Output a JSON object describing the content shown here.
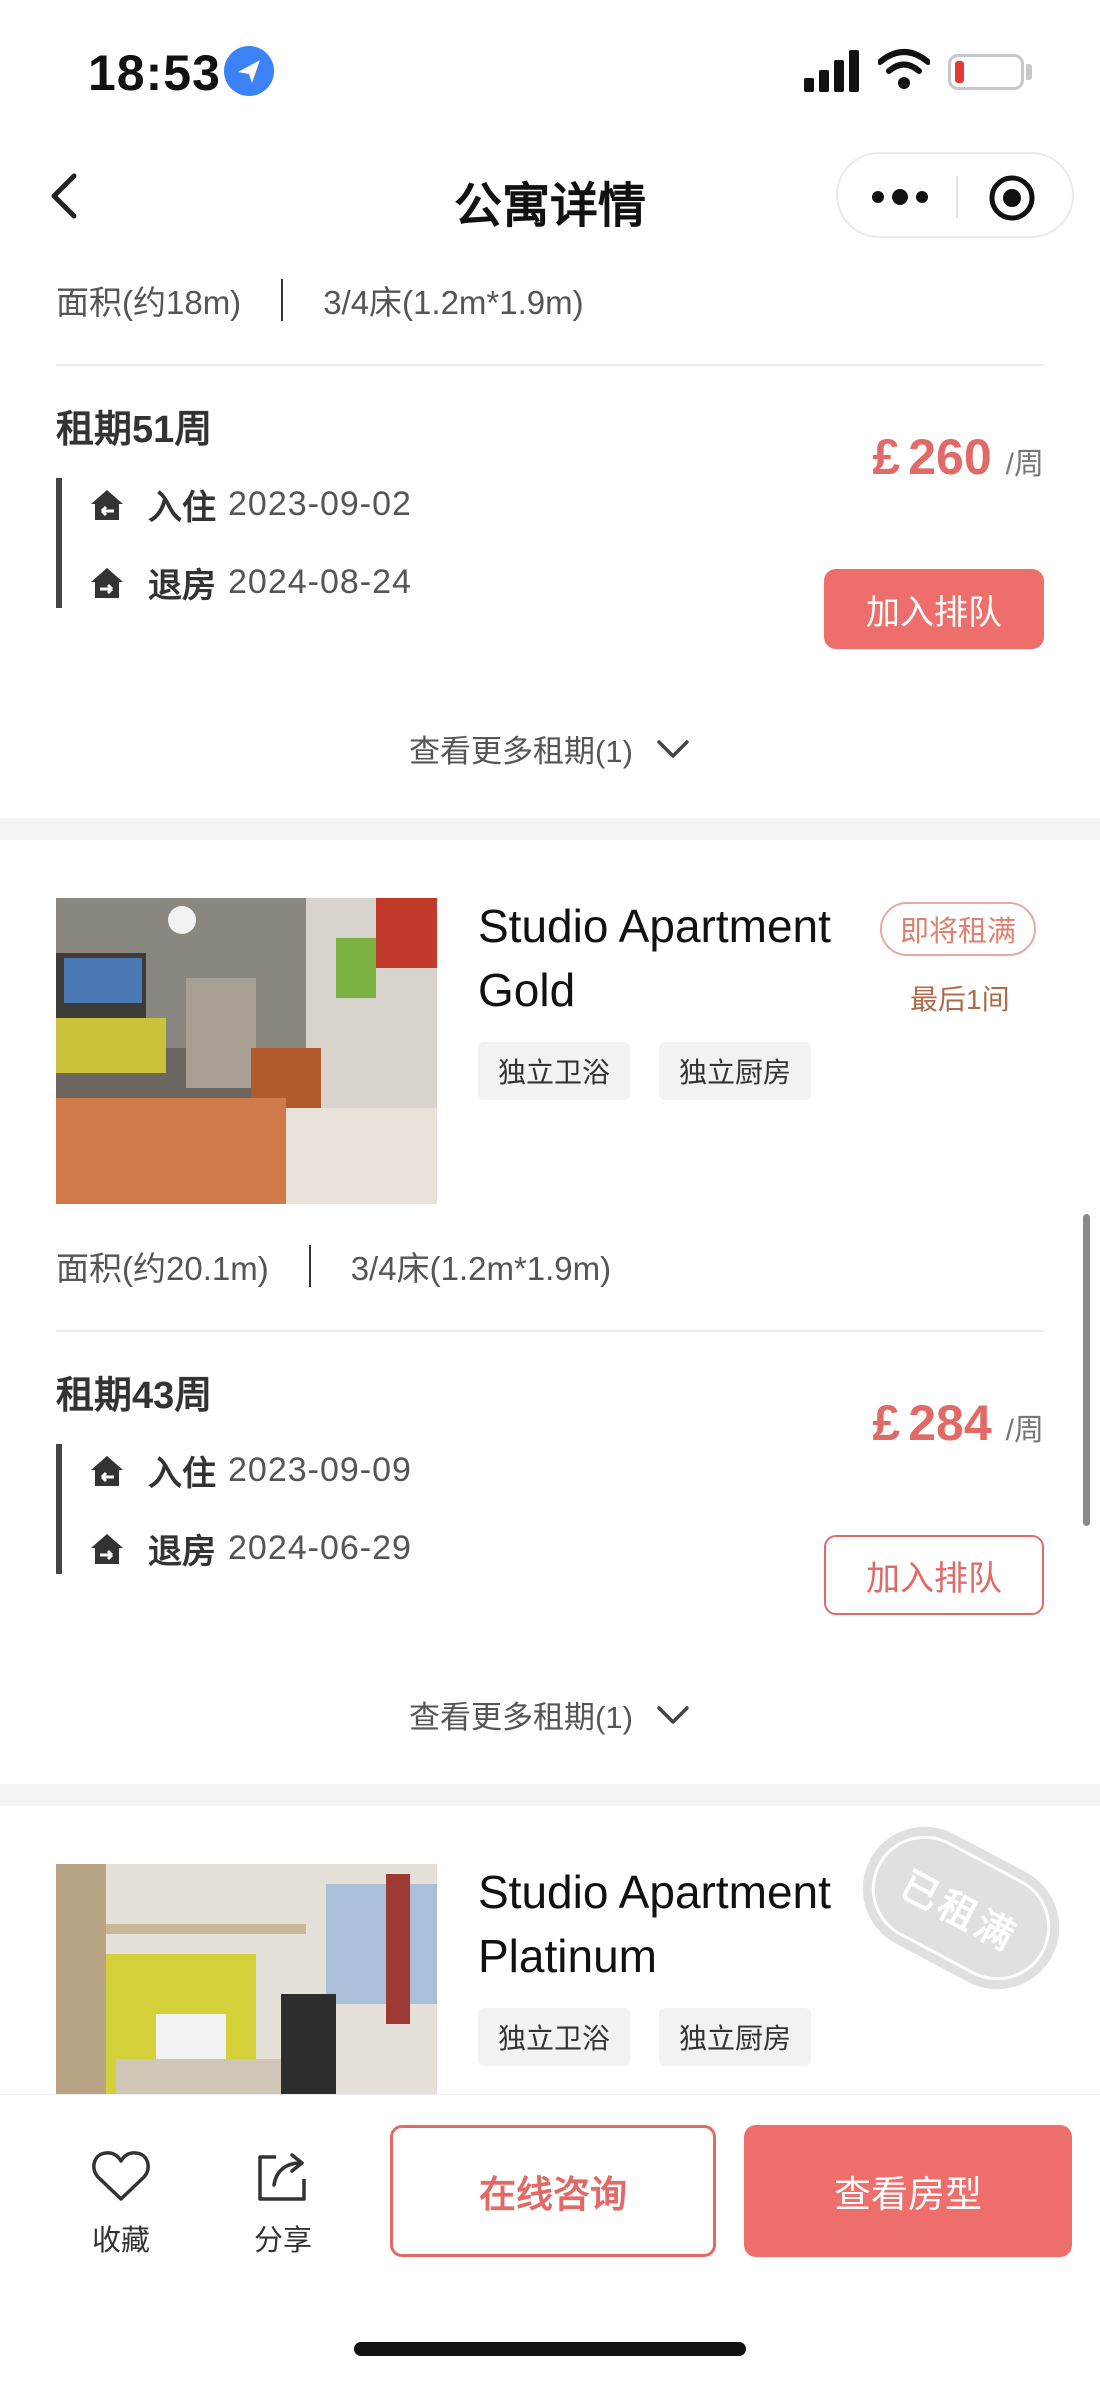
{
  "status_bar": {
    "time": "18:53"
  },
  "nav": {
    "title": "公寓详情"
  },
  "room1": {
    "area": "面积(约18m)",
    "bed": "3/4床(1.2m*1.9m)",
    "term": "租期51周",
    "checkin_label": "入住",
    "checkin_date": "2023-09-02",
    "checkout_label": "退房",
    "checkout_date": "2024-08-24",
    "currency": "£",
    "price": "260",
    "unit": "/周",
    "queue_label": "加入排队",
    "more_terms": "查看更多租期(1)"
  },
  "room2": {
    "name_line1": "Studio Apartment",
    "name_line2": "Gold",
    "badge": "即将租满",
    "availability": "最后1间",
    "tags": [
      "独立卫浴",
      "独立厨房"
    ],
    "area": "面积(约20.1m)",
    "bed": "3/4床(1.2m*1.9m)",
    "term": "租期43周",
    "checkin_label": "入住",
    "checkin_date": "2023-09-09",
    "checkout_label": "退房",
    "checkout_date": "2024-06-29",
    "currency": "£",
    "price": "284",
    "unit": "/周",
    "queue_label": "加入排队",
    "more_terms": "查看更多租期(1)"
  },
  "room3": {
    "name_line1": "Studio Apartment",
    "name_line2": "Platinum",
    "stamp": "已租满",
    "tags": [
      "独立卫浴",
      "独立厨房"
    ]
  },
  "bottom_bar": {
    "favorite": "收藏",
    "share": "分享",
    "consult": "在线咨询",
    "view_rooms": "查看房型"
  },
  "colors": {
    "accent": "#ee6e6b",
    "price": "#e26a66",
    "badge": "#e0806f"
  }
}
